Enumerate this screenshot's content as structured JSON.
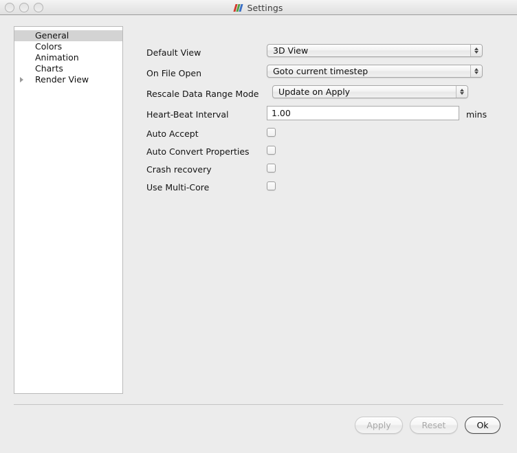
{
  "window": {
    "title": "Settings",
    "app_icon": "paraview-logo-icon",
    "controls": [
      "close-button",
      "minimize-button",
      "zoom-button"
    ]
  },
  "sidebar": {
    "items": [
      {
        "label": "General",
        "selected": true,
        "expandable": false
      },
      {
        "label": "Colors",
        "selected": false,
        "expandable": false
      },
      {
        "label": "Animation",
        "selected": false,
        "expandable": false
      },
      {
        "label": "Charts",
        "selected": false,
        "expandable": false
      },
      {
        "label": "Render View",
        "selected": false,
        "expandable": true
      }
    ]
  },
  "form": {
    "default_view": {
      "label": "Default View",
      "value": "3D View"
    },
    "on_file_open": {
      "label": "On File Open",
      "value": "Goto current timestep"
    },
    "rescale_data_range_mode": {
      "label": "Rescale Data Range Mode",
      "value": "Update on Apply"
    },
    "heart_beat_interval": {
      "label": "Heart-Beat Interval",
      "value": "1.00",
      "placeholder": "",
      "unit": "mins"
    },
    "auto_accept": {
      "label": "Auto Accept",
      "checked": false
    },
    "auto_convert_properties": {
      "label": "Auto Convert Properties",
      "checked": false
    },
    "crash_recovery": {
      "label": "Crash recovery",
      "checked": false
    },
    "use_multi_core": {
      "label": "Use Multi-Core",
      "checked": false
    }
  },
  "footer": {
    "apply_label": "Apply",
    "reset_label": "Reset",
    "ok_label": "Ok"
  }
}
